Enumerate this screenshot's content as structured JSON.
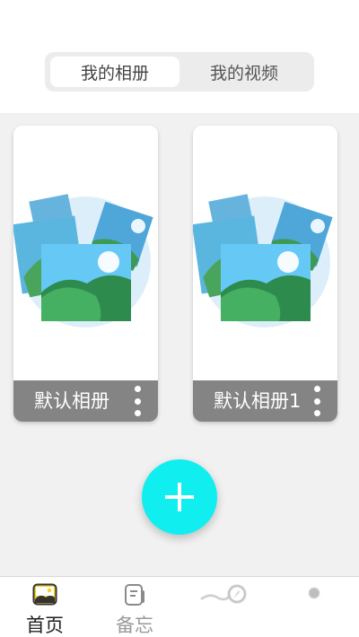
{
  "top_tabs": {
    "items": [
      {
        "label": "我的相册",
        "active": true
      },
      {
        "label": "我的视频",
        "active": false
      }
    ]
  },
  "albums": [
    {
      "name": "默认相册",
      "icon": "photo-placeholder-icon"
    },
    {
      "name": "默认相册1",
      "icon": "photo-placeholder-icon"
    }
  ],
  "fab": {
    "icon": "plus-icon",
    "color": "#11eef0"
  },
  "bottom_nav": {
    "items": [
      {
        "label": "首页",
        "icon": "gallery-icon",
        "active": true
      },
      {
        "label": "备忘",
        "icon": "memo-icon",
        "active": false
      },
      {
        "label": "",
        "icon": "compass-icon",
        "active": false
      },
      {
        "label": "",
        "icon": "profile-icon",
        "active": false
      }
    ]
  },
  "colors": {
    "accent": "#11eef0",
    "album_bar": "#848484",
    "background": "#f1f1f1"
  }
}
